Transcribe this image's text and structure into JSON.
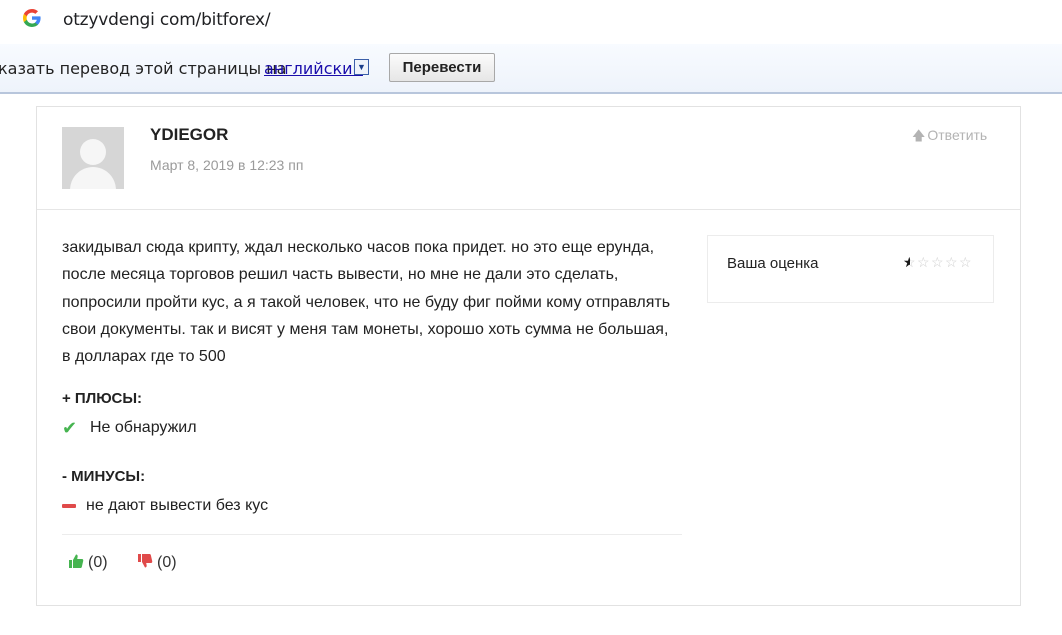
{
  "browser": {
    "url": "otzyvdengi com/bitforex/"
  },
  "translate_bar": {
    "prompt_text": "казать перевод этой страницы на",
    "language": "английский",
    "translate_button": "Перевести"
  },
  "review": {
    "author": "YDIEGOR",
    "date": "Март 8, 2019 в 12:23 пп",
    "reply_label": "Ответить",
    "text": "закидывал сюда крипту, ждал несколько часов пока придет. но это еще ерунда, после месяца торговов решил часть вывести, но мне не дали это сделать, попросили пройти кус, а я такой человек, что не буду фиг пойми кому отправлять свои документы. так и висят у меня там монеты, хорошо хоть сумма не большая, в долларах где то 500",
    "rating_label": "Ваша оценка",
    "rating_value": 0.5,
    "rating_max": 5,
    "pros_title": "+ ПЛЮСЫ:",
    "pros_item": "Не обнаружил",
    "cons_title": "- МИНУСЫ:",
    "cons_item": "не дают вывести без кус",
    "likes": "(0)",
    "dislikes": "(0)"
  },
  "colors": {
    "check": "#46b450",
    "minus": "#e04a4a",
    "like": "#46b450",
    "dislike": "#e04a4a",
    "link": "#1a0dab"
  }
}
